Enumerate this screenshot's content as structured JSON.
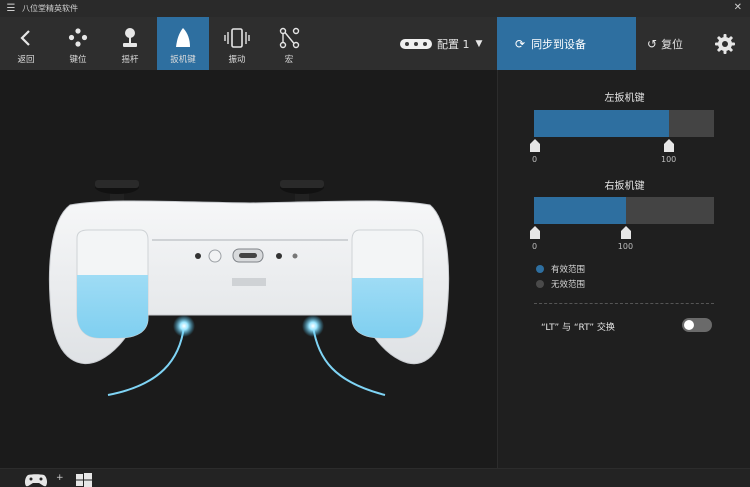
{
  "titlebar": {
    "title": "八位堂精英软件",
    "menu_icon": "hamburger-icon",
    "close_icon": "close-icon"
  },
  "toolbar": {
    "tools": [
      {
        "label": "返回",
        "icon": "back-arrow-icon"
      },
      {
        "label": "键位",
        "icon": "dpad-buttons-icon"
      },
      {
        "label": "摇杆",
        "icon": "joystick-icon"
      },
      {
        "label": "扳机键",
        "icon": "trigger-icon",
        "active": true
      },
      {
        "label": "振动",
        "icon": "vibration-icon"
      },
      {
        "label": "宏",
        "icon": "macro-icon"
      }
    ],
    "profile_label": "配置 1",
    "sync_label": "同步到设备",
    "reset_label": "复位",
    "settings_icon": "gear-icon"
  },
  "triggers": {
    "left": {
      "title": "左扳机键",
      "range_start": "0",
      "range_end": "100",
      "fill_fraction": 0.75
    },
    "right": {
      "title": "右扳机键",
      "range_start": "0",
      "range_end": "100",
      "fill_fraction": 0.51
    }
  },
  "legend": {
    "effective": "有效范围",
    "ineffective": "无效范围"
  },
  "swap": {
    "label": "“LT” 与 “RT” 交换",
    "enabled": false
  },
  "colors": {
    "accent": "#2e6fa0",
    "inactive": "#444444",
    "glow": "#7fd4f5"
  },
  "statusbar": {
    "icons": [
      "gamepad-icon",
      "windows-icon"
    ],
    "separator": "+"
  }
}
